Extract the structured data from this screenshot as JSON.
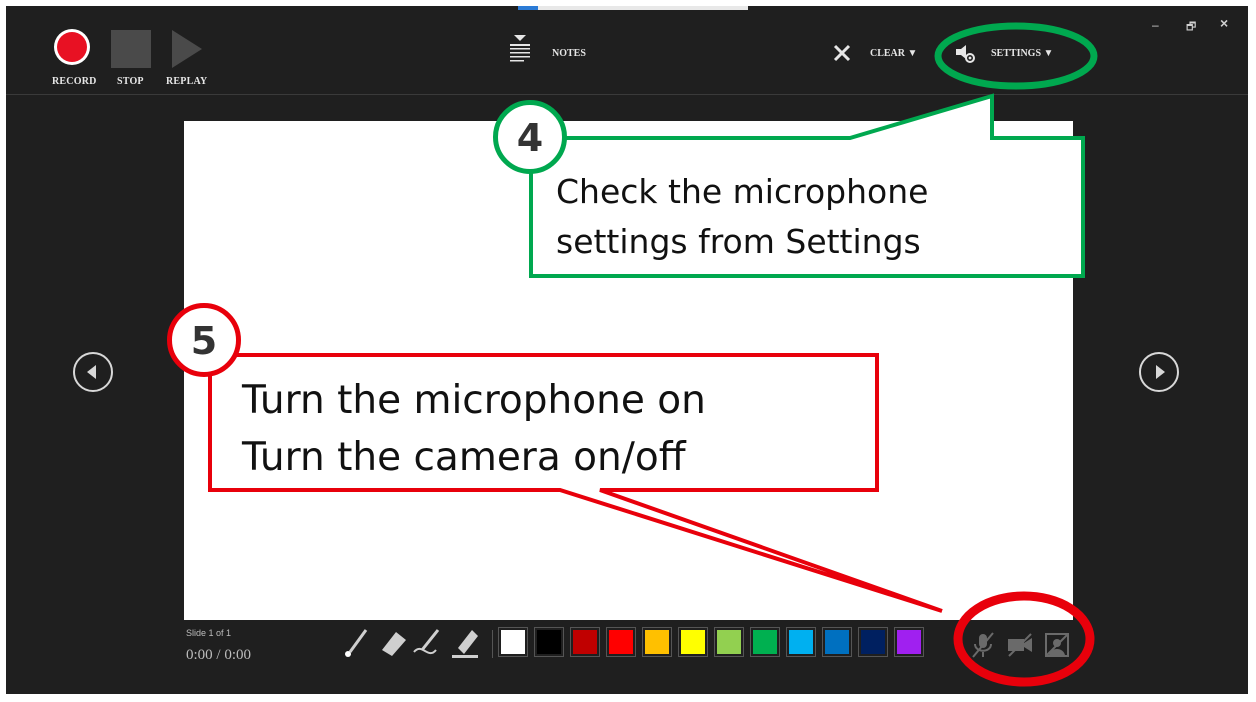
{
  "toolbar": {
    "record_label": "RECORD",
    "stop_label": "STOP",
    "replay_label": "REPLAY",
    "notes_label": "NOTES",
    "clear_label": "CLEAR ▼",
    "settings_label": "SETTINGS ▼",
    "icons": [
      "record-icon",
      "stop-icon",
      "replay-icon",
      "notes-icon",
      "clear-x-icon",
      "settings-icon"
    ]
  },
  "window_controls": {
    "minimize": "–",
    "restore": "🗗",
    "close": "×"
  },
  "slide": {
    "counter": "Slide 1 of 1",
    "timer": "0:00 / 0:00"
  },
  "pen_tools": [
    "laser-pointer-icon",
    "eraser-icon",
    "pen-icon",
    "highlighter-icon"
  ],
  "swatches": [
    "#ffffff",
    "#000000",
    "#c00000",
    "#ff0000",
    "#ffc000",
    "#ffff00",
    "#92d050",
    "#00b050",
    "#00b0f0",
    "#0070c0",
    "#002060",
    "#a020f0"
  ],
  "media_controls": [
    "microphone-off-icon",
    "camera-off-icon",
    "camera-preview-off-icon"
  ],
  "annotations": {
    "callout4": {
      "number": "4",
      "line1": "Check the microphone",
      "line2": "settings from Settings",
      "color": "#00a84f"
    },
    "callout5": {
      "number": "5",
      "line1": "Turn the microphone on",
      "line2": "Turn the camera on/off",
      "color": "#e8000b"
    }
  }
}
